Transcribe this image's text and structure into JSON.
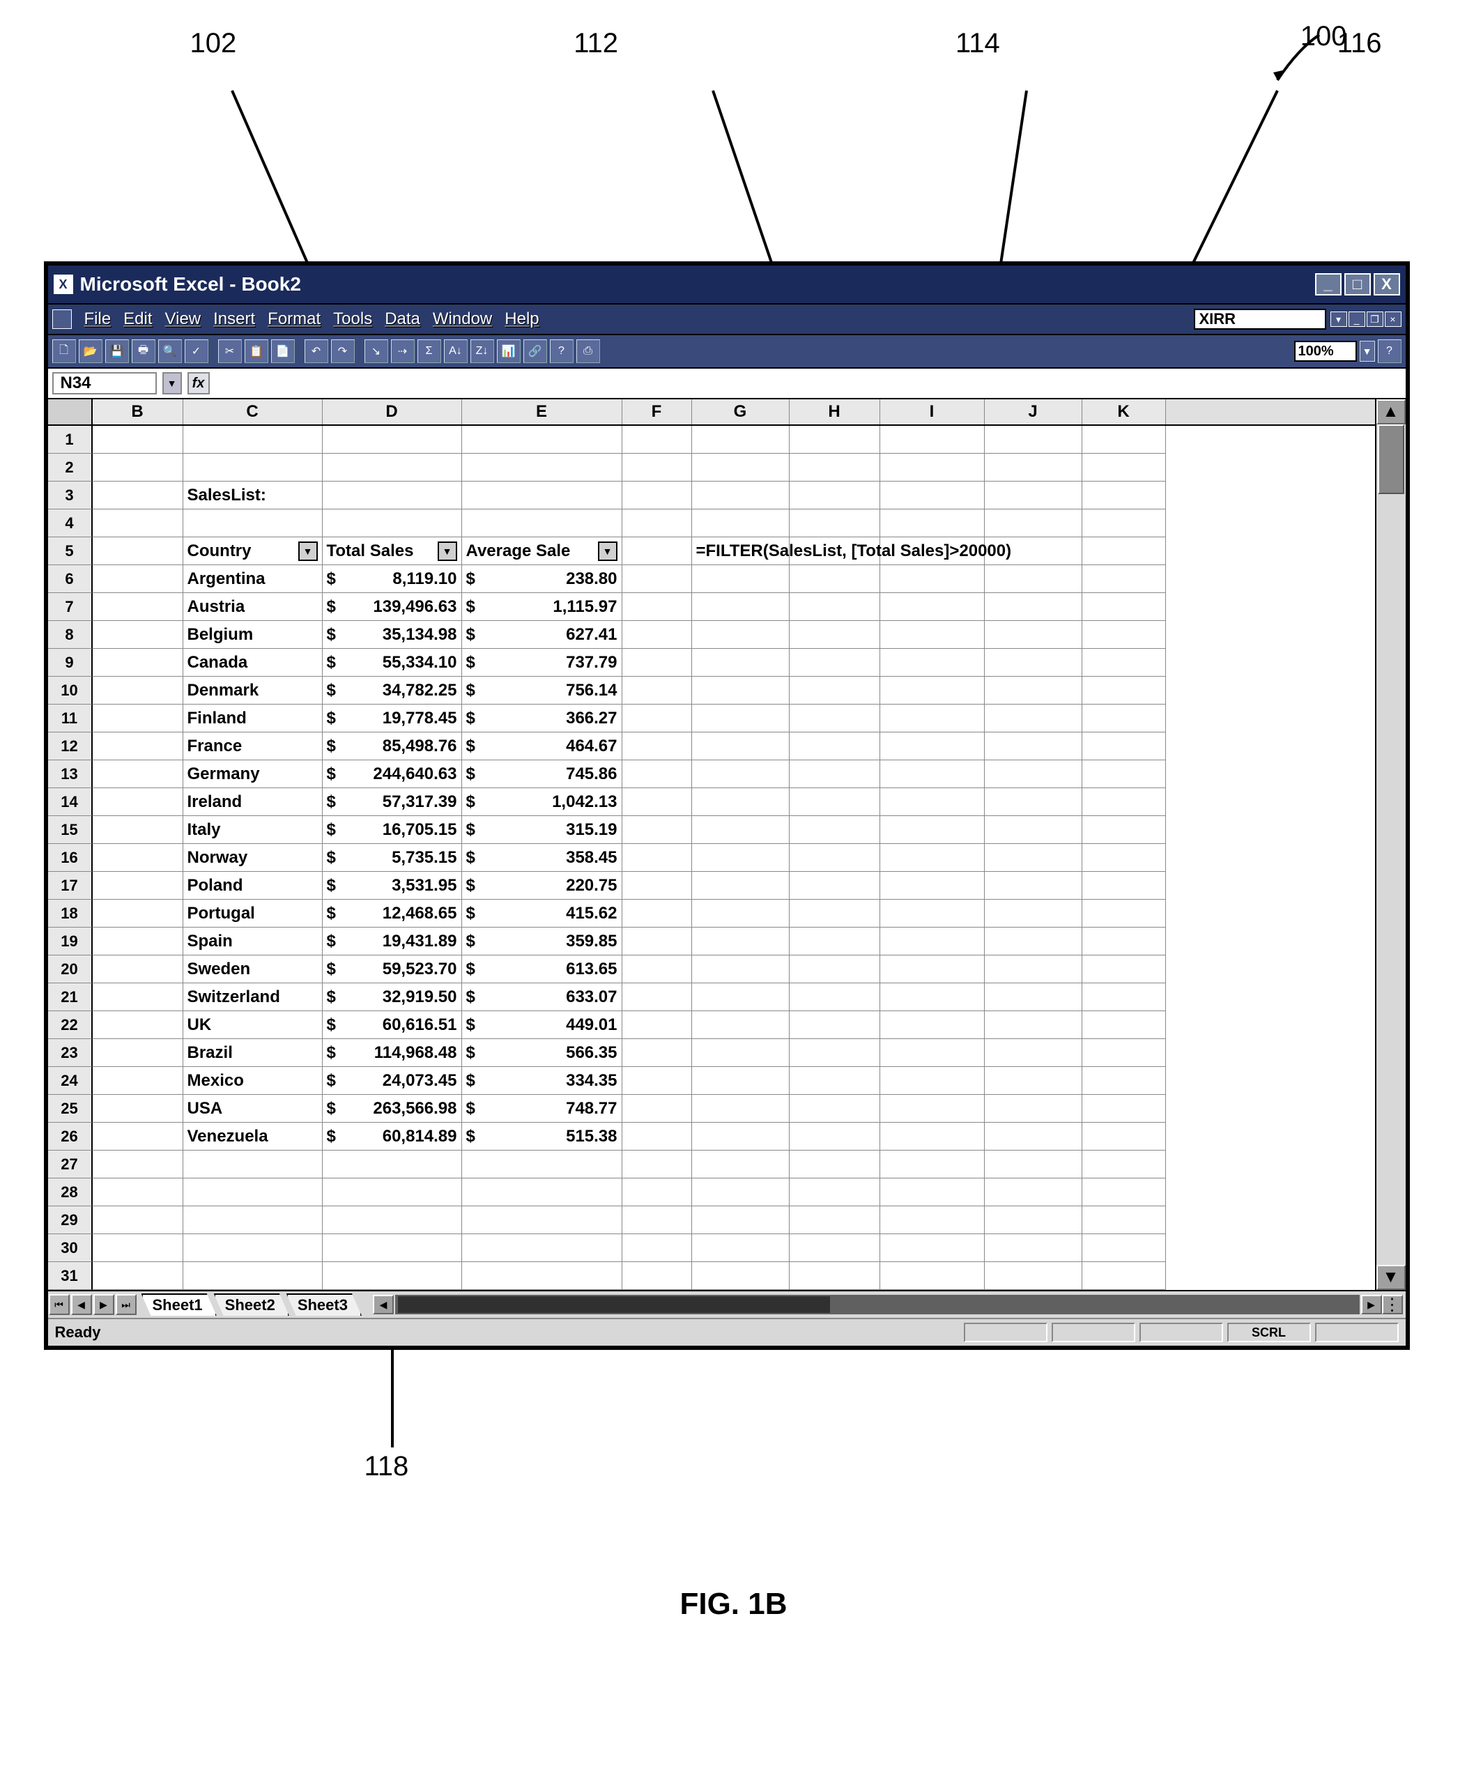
{
  "figure": {
    "label_main": "100",
    "label_102": "102",
    "label_112": "112",
    "label_114": "114",
    "label_116": "116",
    "label_118": "118",
    "caption": "FIG. 1B"
  },
  "titlebar": {
    "app_icon": "X",
    "title": "Microsoft Excel - Book2",
    "minimize": "_",
    "maximize": "□",
    "close": "X"
  },
  "menubar": {
    "items": [
      "File",
      "Edit",
      "View",
      "Insert",
      "Format",
      "Tools",
      "Data",
      "Window",
      "Help"
    ],
    "help_value": "XIRR",
    "mdi": {
      "min": "_",
      "restore": "❐",
      "close": "×"
    }
  },
  "toolbar": {
    "icons": [
      "🗋",
      "📂",
      "💾",
      "🖶",
      "🔍",
      "✓",
      "✂",
      "📋",
      "📄",
      "↶",
      "↷",
      "↘",
      "⇢",
      "Σ",
      "A↓",
      "Z↓",
      "📊",
      "🔗",
      "?",
      "⎙"
    ],
    "zoom": "100%"
  },
  "formulabar": {
    "name": "N34",
    "fx": "fx",
    "value": ""
  },
  "columns": [
    "B",
    "C",
    "D",
    "E",
    "F",
    "G",
    "H",
    "I",
    "J",
    "K"
  ],
  "sheet": {
    "label_cell": "SalesList:",
    "hdr_country": "Country",
    "hdr_total": "Total Sales",
    "hdr_avg": "Average Sale",
    "formula_g5": "=FILTER(SalesList, [Total Sales]>20000)",
    "rows": [
      {
        "c": "Argentina",
        "d": "8,119.10",
        "e": "238.80"
      },
      {
        "c": "Austria",
        "d": "139,496.63",
        "e": "1,115.97"
      },
      {
        "c": "Belgium",
        "d": "35,134.98",
        "e": "627.41"
      },
      {
        "c": "Canada",
        "d": "55,334.10",
        "e": "737.79"
      },
      {
        "c": "Denmark",
        "d": "34,782.25",
        "e": "756.14"
      },
      {
        "c": "Finland",
        "d": "19,778.45",
        "e": "366.27"
      },
      {
        "c": "France",
        "d": "85,498.76",
        "e": "464.67"
      },
      {
        "c": "Germany",
        "d": "244,640.63",
        "e": "745.86"
      },
      {
        "c": "Ireland",
        "d": "57,317.39",
        "e": "1,042.13"
      },
      {
        "c": "Italy",
        "d": "16,705.15",
        "e": "315.19"
      },
      {
        "c": "Norway",
        "d": "5,735.15",
        "e": "358.45"
      },
      {
        "c": "Poland",
        "d": "3,531.95",
        "e": "220.75"
      },
      {
        "c": "Portugal",
        "d": "12,468.65",
        "e": "415.62"
      },
      {
        "c": "Spain",
        "d": "19,431.89",
        "e": "359.85"
      },
      {
        "c": "Sweden",
        "d": "59,523.70",
        "e": "613.65"
      },
      {
        "c": "Switzerland",
        "d": "32,919.50",
        "e": "633.07"
      },
      {
        "c": "UK",
        "d": "60,616.51",
        "e": "449.01"
      },
      {
        "c": "Brazil",
        "d": "114,968.48",
        "e": "566.35"
      },
      {
        "c": "Mexico",
        "d": "24,073.45",
        "e": "334.35"
      },
      {
        "c": "USA",
        "d": "263,566.98",
        "e": "748.77"
      },
      {
        "c": "Venezuela",
        "d": "60,814.89",
        "e": "515.38"
      }
    ],
    "currency": "$"
  },
  "tabs": {
    "nav": [
      "⏮",
      "◀",
      "▶",
      "⏭"
    ],
    "sheets": [
      "Sheet1",
      "Sheet2",
      "Sheet3"
    ],
    "active": 0
  },
  "statusbar": {
    "ready": "Ready",
    "scrl": "SCRL"
  }
}
